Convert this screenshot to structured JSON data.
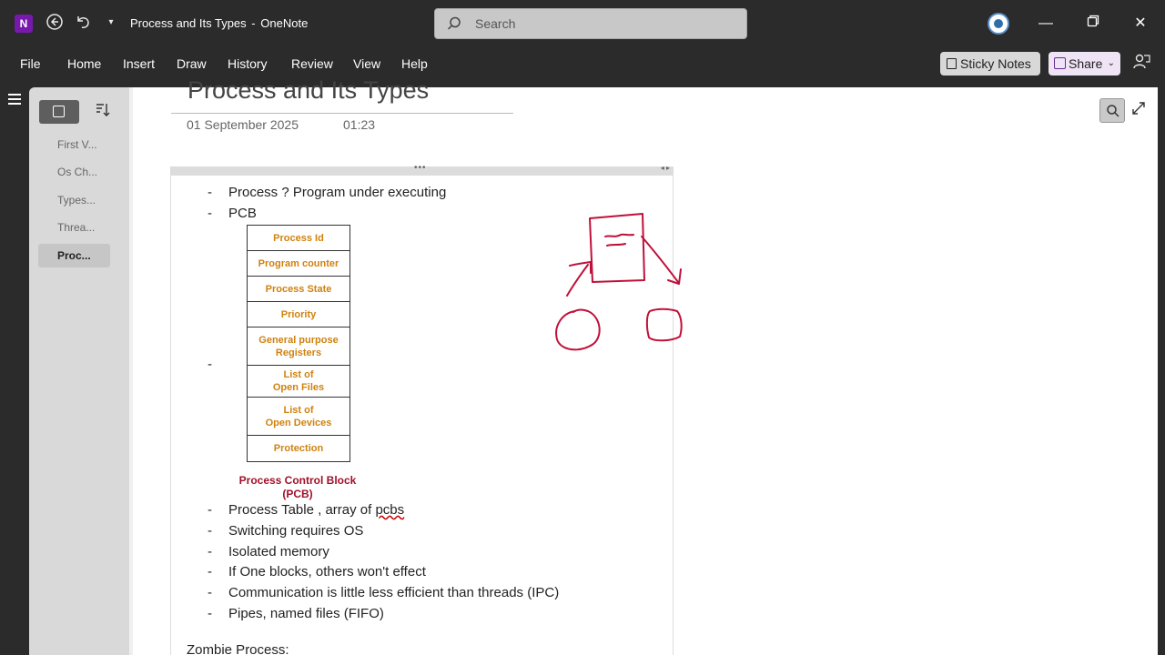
{
  "window": {
    "title": "Process and Its Types",
    "app_name": "OneNote",
    "title_separator": "-",
    "app_logo_letter": "N",
    "search_placeholder": "Search"
  },
  "menu": {
    "items": [
      "File",
      "Home",
      "Insert",
      "Draw",
      "History",
      "Review",
      "View",
      "Help"
    ],
    "sticky_notes": "Sticky Notes",
    "share": "Share"
  },
  "pages": [
    {
      "label": "First V...",
      "active": false
    },
    {
      "label": "Os Ch...",
      "active": false
    },
    {
      "label": "Types...",
      "active": false
    },
    {
      "label": "Threa...",
      "active": false
    },
    {
      "label": "Proc...",
      "active": true
    }
  ],
  "page": {
    "title": "Process and Its Types",
    "date": "01 September 2025",
    "time": "01:23"
  },
  "notes": {
    "bullets_top": [
      {
        "text": "Process ? Program under executing"
      },
      {
        "text": "PCB"
      }
    ],
    "pcb_rows": [
      "Process Id",
      "Program counter",
      "Process State",
      "Priority",
      "General purpose\nRegisters",
      "List of\nOpen Files",
      "List of\nOpen Devices",
      "Protection"
    ],
    "pcb_caption_line1": "Process Control Block",
    "pcb_caption_line2": "(PCB)",
    "bullets_bottom": [
      {
        "pre": "Process Table , array of ",
        "squiggle": "pcbs"
      },
      {
        "pre": "Switching requires OS",
        "squiggle": ""
      },
      {
        "pre": "Isolated memory",
        "squiggle": ""
      },
      {
        "pre": "If One blocks, others won't effect",
        "squiggle": ""
      },
      {
        "pre": "Communication is little less efficient than threads (IPC)",
        "squiggle": ""
      },
      {
        "pre": "Pipes, named files (FIFO)",
        "squiggle": ""
      }
    ],
    "zombie_heading": "Zombie Process:"
  },
  "colors": {
    "pcb_text": "#d0820f",
    "pcb_caption": "#a0112a",
    "ink": "#c0103a",
    "onenote_purple": "#7719aa"
  }
}
